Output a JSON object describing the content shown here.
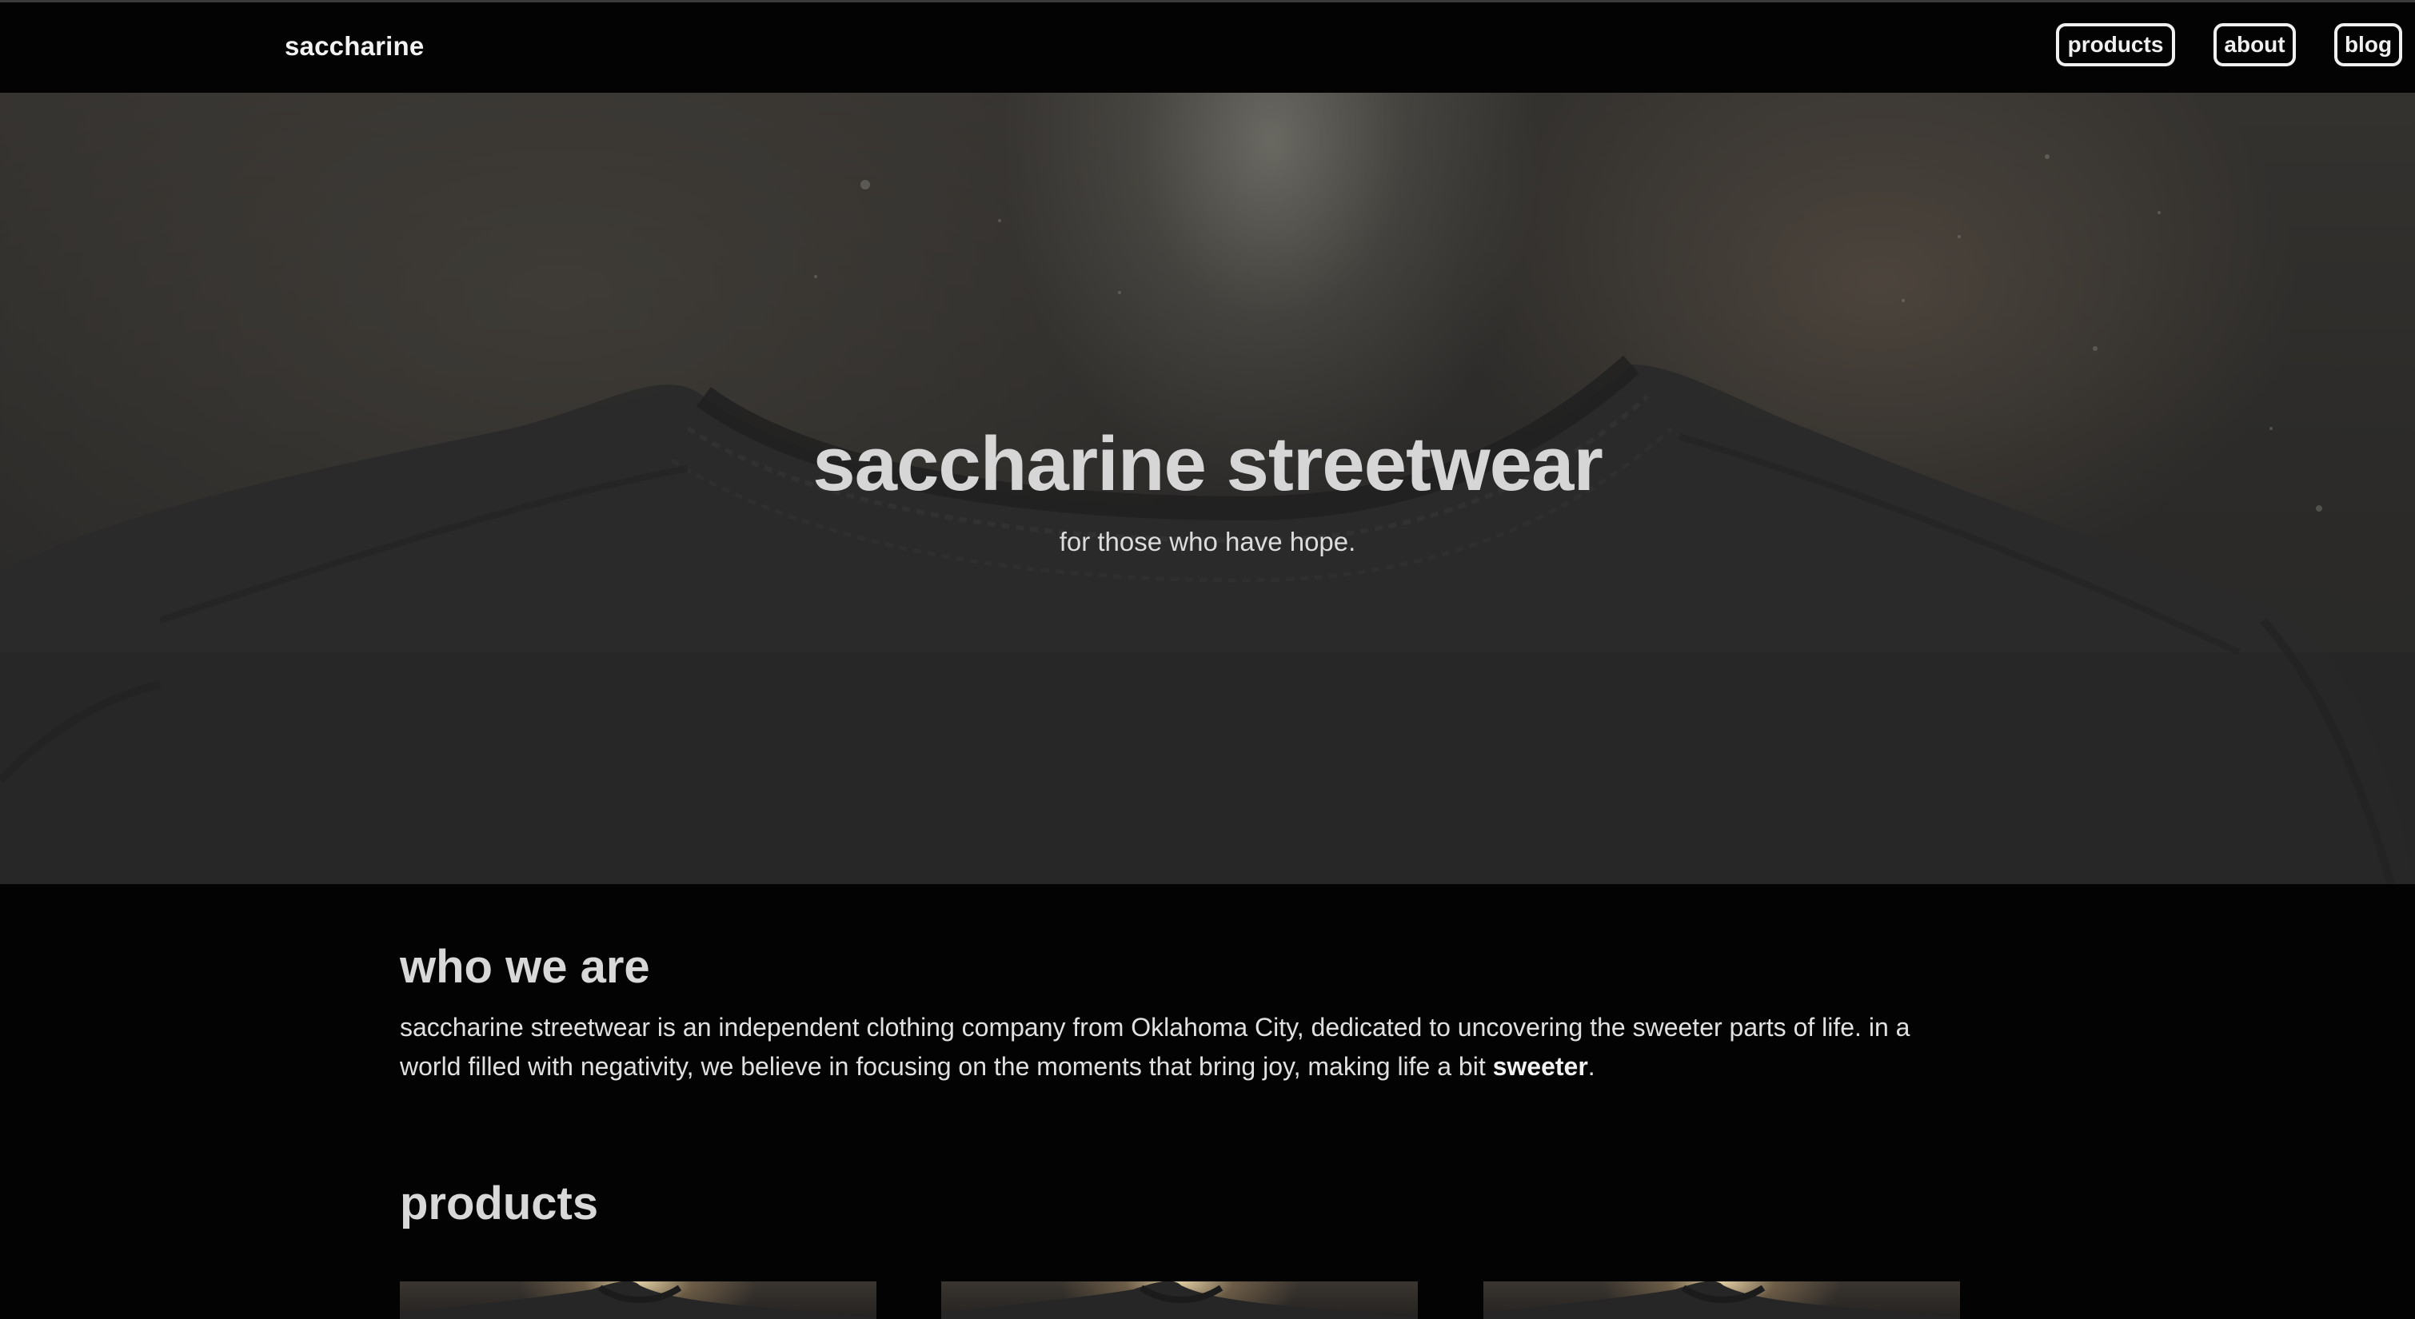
{
  "navbar": {
    "brand": "saccharine",
    "links": [
      {
        "label": "products"
      },
      {
        "label": "about"
      },
      {
        "label": "blog"
      }
    ]
  },
  "hero": {
    "title": "saccharine streetwear",
    "subtitle": "for those who have hope."
  },
  "about": {
    "heading": "who we are",
    "text_before": "saccharine streetwear is an independent clothing company from Oklahoma City, dedicated to uncovering the sweeter parts of life. in a world filled with negativity, we believe in focusing on the moments that bring joy, making life a bit ",
    "text_bold": "sweeter",
    "text_after": "."
  },
  "products": {
    "heading": "products",
    "items": [
      {
        "image": "tshirt-product-image"
      },
      {
        "image": "tshirt-product-image"
      },
      {
        "image": "tshirt-product-image"
      }
    ]
  },
  "colors": {
    "background": "#030303",
    "text": "#d4d4d4",
    "nav_border": "#f0f0f0"
  }
}
